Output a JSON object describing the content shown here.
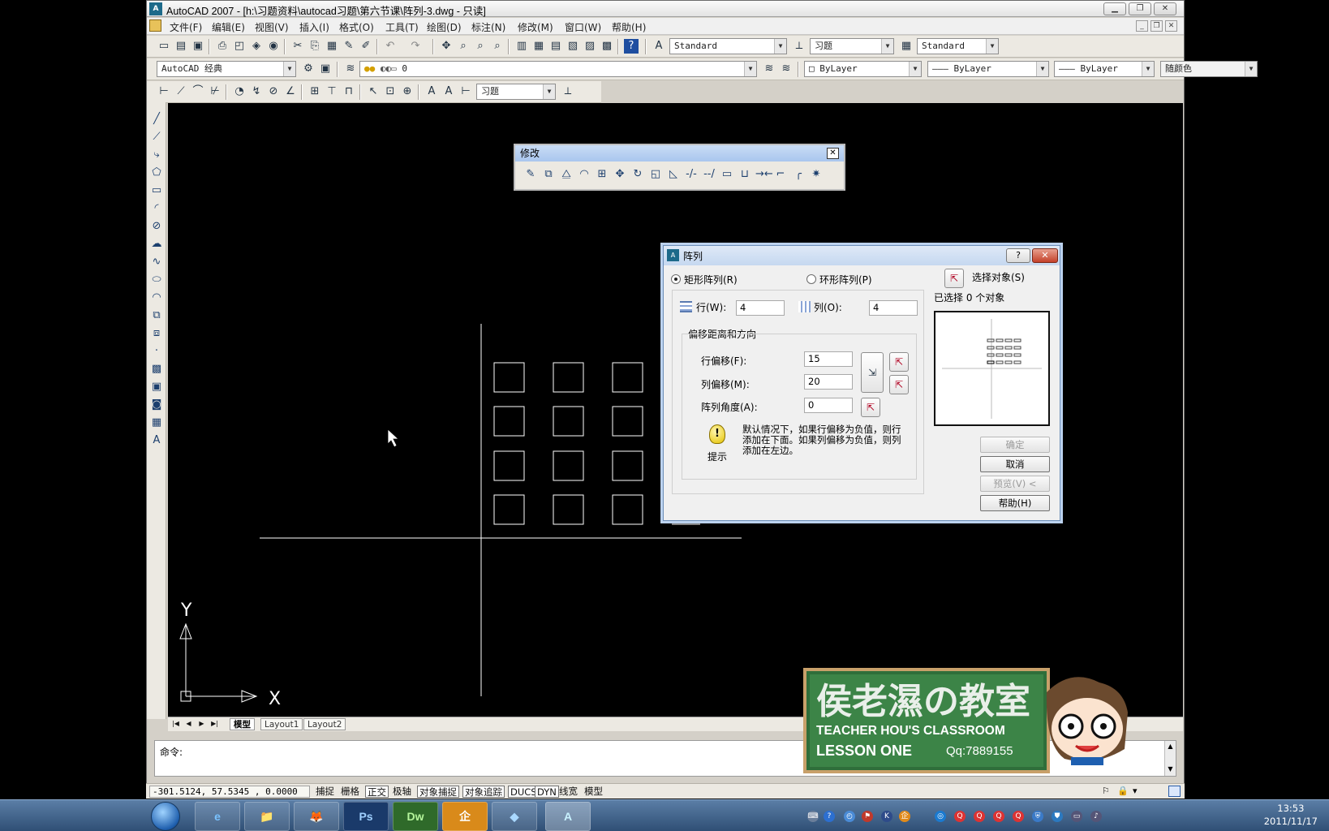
{
  "window": {
    "title": "AutoCAD 2007 - [h:\\习题资料\\autocad习题\\第六节课\\阵列-3.dwg - 只读]",
    "app_icon_text": "A"
  },
  "menu": {
    "items": [
      "文件(F)",
      "编辑(E)",
      "视图(V)",
      "插入(I)",
      "格式(O)",
      "工具(T)",
      "绘图(D)",
      "标注(N)",
      "修改(M)",
      "窗口(W)",
      "帮助(H)"
    ]
  },
  "toolbar": {
    "text_style": "Standard",
    "dim_style": "习题",
    "table_style": "Standard",
    "workspace": "AutoCAD 经典",
    "layer": "0",
    "color": "ByLayer",
    "linetype": "ByLayer",
    "lineweight": "ByLayer",
    "plot_style": "随颜色",
    "dim_style_2": "习题"
  },
  "modify_toolbar": {
    "title": "修改",
    "close": "✕"
  },
  "array_dialog": {
    "title": "阵列",
    "help": "?",
    "close": "✕",
    "rect_array": "矩形阵列(R)",
    "polar_array": "环形阵列(P)",
    "select_objects": "选择对象(S)",
    "selected_count": "已选择 0 个对象",
    "rows_label": "行(W):",
    "rows_value": "4",
    "cols_label": "列(O):",
    "cols_value": "4",
    "offset_group": "偏移距离和方向",
    "row_offset_label": "行偏移(F):",
    "row_offset_value": "15",
    "col_offset_label": "列偏移(M):",
    "col_offset_value": "20",
    "angle_label": "阵列角度(A):",
    "angle_value": "0",
    "hint_text": "默认情况下，如果行偏移为负值，则行添加在下面。如果列偏移为负值，则列添加在左边。",
    "hint_caption": "提示",
    "ok": "确定",
    "cancel": "取消",
    "preview": "预览(V) <",
    "help_btn": "帮助(H)"
  },
  "ucs": {
    "x_label": "X",
    "y_label": "Y"
  },
  "layout_tabs": [
    "模型",
    "Layout1",
    "Layout2"
  ],
  "command": {
    "prompt": "命令:"
  },
  "status": {
    "coords": "-301.5124, 57.5345 , 0.0000",
    "buttons": [
      "捕捉",
      "栅格",
      "正交",
      "极轴",
      "对象捕捉",
      "对象追踪",
      "DUCS",
      "DYN",
      "线宽",
      "模型"
    ]
  },
  "taskbar": {
    "apps": [
      "e",
      "📁",
      "🦊",
      "Ps",
      "Dw",
      "企",
      "◆",
      "A"
    ],
    "time": "13:53",
    "date": "2011/11/17"
  },
  "watermark": {
    "title": "侯老濕の教室",
    "subtitle": "TEACHER HOU'S CLASSROOM",
    "lesson": "LESSON ONE",
    "qq": "Qq:7889155"
  }
}
